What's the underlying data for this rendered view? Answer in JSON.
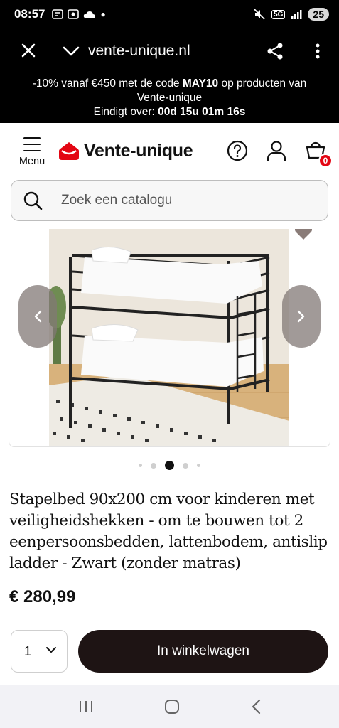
{
  "status": {
    "time": "08:57",
    "network": "5G",
    "battery": "25"
  },
  "browser": {
    "url": "vente-unique.nl"
  },
  "promo": {
    "line1_prefix": "-10% vanaf €450 met de code ",
    "code": "MAY10",
    "line1_suffix": " op producten van",
    "line2": "Vente-unique",
    "countdown_label": "Eindigt over: ",
    "countdown_value": "00d 15u 01m 16s"
  },
  "header": {
    "menu_label": "Menu",
    "logo_text": "Vente-unique",
    "cart_count": "0"
  },
  "search": {
    "placeholder": "Zoek een catalogu"
  },
  "gallery": {
    "active_index": 2,
    "total": 5
  },
  "product": {
    "title": "Stapelbed 90x200 cm voor kinderen met veiligheidshekken - om te bouwen tot 2 eenpersoonsbedden, lattenbodem, antislip ladder - Zwart (zonder matras)",
    "price": "€ 280,99",
    "quantity": "1",
    "add_to_cart_label": "In winkelwagen"
  },
  "colors": {
    "brand_red": "#e30613",
    "button_dark": "#1e1414"
  },
  "icons": [
    "close-icon",
    "chevron-down-icon",
    "share-icon",
    "more-icon",
    "menu-icon",
    "help-icon",
    "user-icon",
    "cart-icon",
    "search-icon",
    "chevron-left-icon",
    "chevron-right-icon",
    "heart-icon"
  ]
}
